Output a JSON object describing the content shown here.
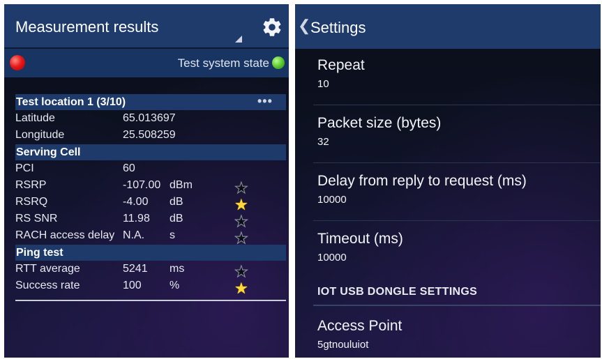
{
  "measurement": {
    "title": "Measurement results",
    "state_label": "Test system state",
    "location_title": "Test location 1 (3/10)",
    "more_label": "•••",
    "location_rows": [
      {
        "name": "Latitude",
        "value": "65.013697"
      },
      {
        "name": "Longitude",
        "value": "25.508259"
      }
    ],
    "serving_cell_title": "Serving Cell",
    "serving_rows": [
      {
        "name": "PCI",
        "value": "60",
        "unit": "",
        "stars": null
      },
      {
        "name": "RSRP",
        "value": "-107.00",
        "unit": "dBm",
        "stars": 2
      },
      {
        "name": "RSRQ",
        "value": "-4.00",
        "unit": "dB",
        "stars": 3
      },
      {
        "name": "RS SNR",
        "value": "11.98",
        "unit": "dB",
        "stars": 0
      },
      {
        "name": "RACH access delay",
        "value": "N.A.",
        "unit": "s",
        "stars": 0
      }
    ],
    "ping_title": "Ping test",
    "ping_rows": [
      {
        "name": "RTT average",
        "value": "5241",
        "unit": "ms",
        "stars": 1
      },
      {
        "name": "Success rate",
        "value": "100",
        "unit": "%",
        "stars": 3
      }
    ],
    "colors": {
      "state_red": "#e8191b",
      "state_green": "#54c22a",
      "star": "#ffd83a"
    }
  },
  "settings": {
    "title": "Settings",
    "items": [
      {
        "label": "Repeat",
        "value": "10"
      },
      {
        "label": "Packet size (bytes)",
        "value": "32"
      },
      {
        "label": "Delay from reply to request (ms)",
        "value": "10000"
      },
      {
        "label": "Timeout (ms)",
        "value": "10000"
      }
    ],
    "section_title": "IOT USB DONGLE SETTINGS",
    "section_items": [
      {
        "label": "Access Point",
        "value": "5gtnouluiot"
      }
    ]
  },
  "icons": {
    "gear": "gear-icon",
    "back": "back-chevron-icon",
    "star": "star-icon"
  }
}
